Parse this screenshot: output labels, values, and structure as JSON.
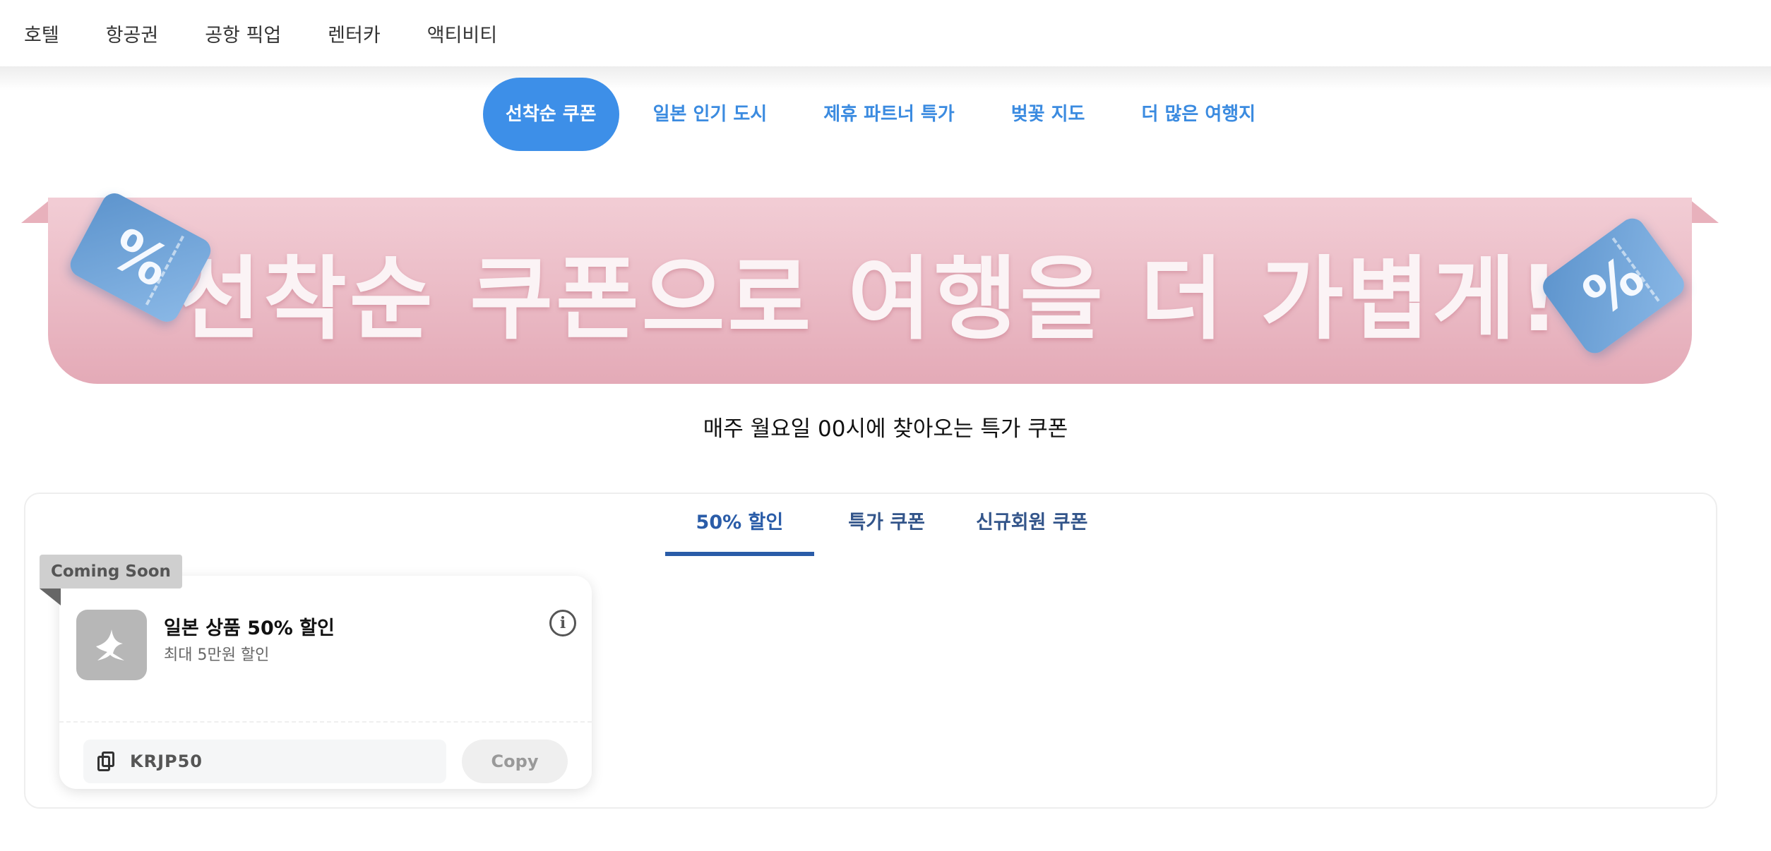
{
  "topnav": {
    "items": [
      "호텔",
      "항공권",
      "공항 픽업",
      "렌터카",
      "액티비티"
    ]
  },
  "pill_tabs": {
    "items": [
      "선착순 쿠폰",
      "일본 인기 도시",
      "제휴 파트너 특가",
      "벚꽃 지도",
      "더 많은 여행지"
    ],
    "active_index": 0
  },
  "banner": {
    "text": "선착순 쿠폰으로 여행을 더 가볍게!",
    "left_ticket_symbol": "%",
    "right_ticket_symbol": "%",
    "background_color": "#e8b1bc",
    "ticket_color": "#6a9fd4"
  },
  "subtitle": "매주 월요일 00시에 찾아오는 특가 쿠폰",
  "coupon_tabs": {
    "items": [
      "50% 할인",
      "특가 쿠폰",
      "신규회원 쿠폰"
    ],
    "active_index": 0
  },
  "coupon": {
    "badge": "Coming Soon",
    "title": "일본 상품 50% 할인",
    "subtitle": "최대 5만원 할인",
    "info_icon": "i",
    "code": "KRJP50",
    "copy_label": "Copy"
  },
  "colors": {
    "accent": "#3d8fe8",
    "tab_active": "#2a5ca8"
  }
}
